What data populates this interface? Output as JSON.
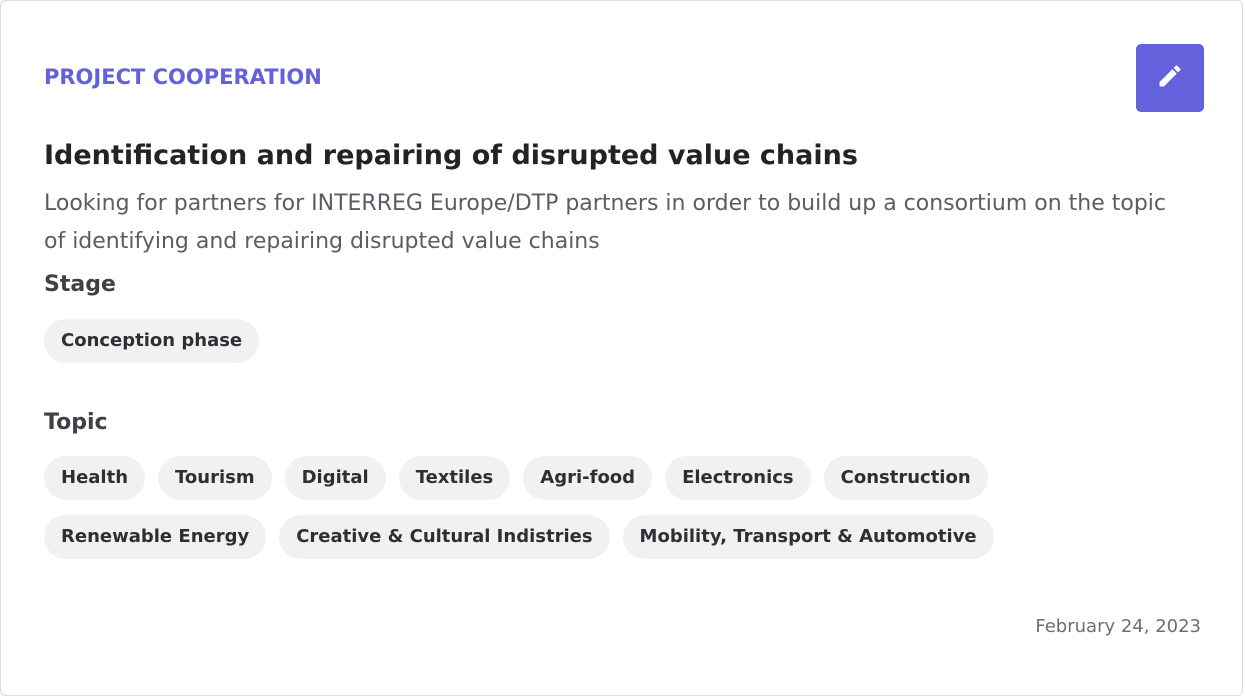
{
  "card": {
    "category": "PROJECT COOPERATION",
    "title": "Identification and repairing of disrupted value chains",
    "description": "Looking for partners for INTERREG Europe/DTP partners in order to build up a consortium on the topic of identifying and repairing disrupted value chains",
    "stage_label": "Stage",
    "stages": [
      "Conception phase"
    ],
    "topic_label": "Topic",
    "topics_row_1": [
      "Health",
      "Tourism",
      "Digital",
      "Textiles",
      "Agri-food",
      "Electronics",
      "Construction"
    ],
    "topics_row_2": [
      "Renewable Energy",
      "Creative & Cultural Indistries",
      "Mobility, Transport & Automotive"
    ],
    "date": "February 24, 2023",
    "edit_icon": "pencil-icon"
  },
  "colors": {
    "accent": "#6361dc",
    "chip_bg": "#f1f1f2",
    "title": "#222326",
    "muted": "#5a5d63"
  }
}
